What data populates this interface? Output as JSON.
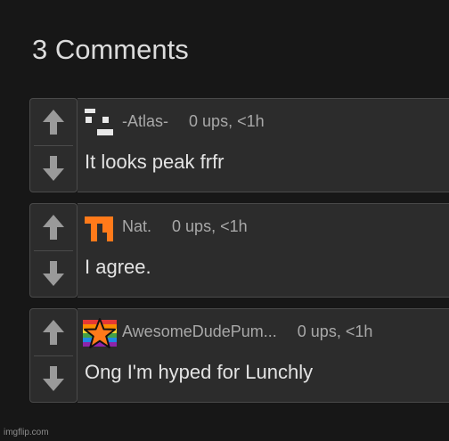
{
  "header": {
    "title": "3 Comments"
  },
  "comments": [
    {
      "user": "-Atlas-",
      "stats": "0 ups, <1h",
      "text": "It looks peak frfr",
      "avatar": "pixel-glyph-avatar"
    },
    {
      "user": "Nat.",
      "stats": "0 ups, <1h",
      "text": "I agree.",
      "avatar": "orange-block-avatar"
    },
    {
      "user": "AwesomeDudePum...",
      "stats": "0 ups, <1h",
      "text": "Ong I'm hyped for Lunchly",
      "avatar": "rainbow-star-avatar"
    }
  ],
  "icons": {
    "upvote": "arrow-up-icon",
    "downvote": "arrow-down-icon"
  },
  "colors": {
    "background": "#171717",
    "card": "#2c2c2c",
    "border": "#4a4a4a",
    "arrow": "#9a9a9a",
    "accent": "#ff7a1a"
  },
  "footer": {
    "watermark": "imgflip.com"
  }
}
